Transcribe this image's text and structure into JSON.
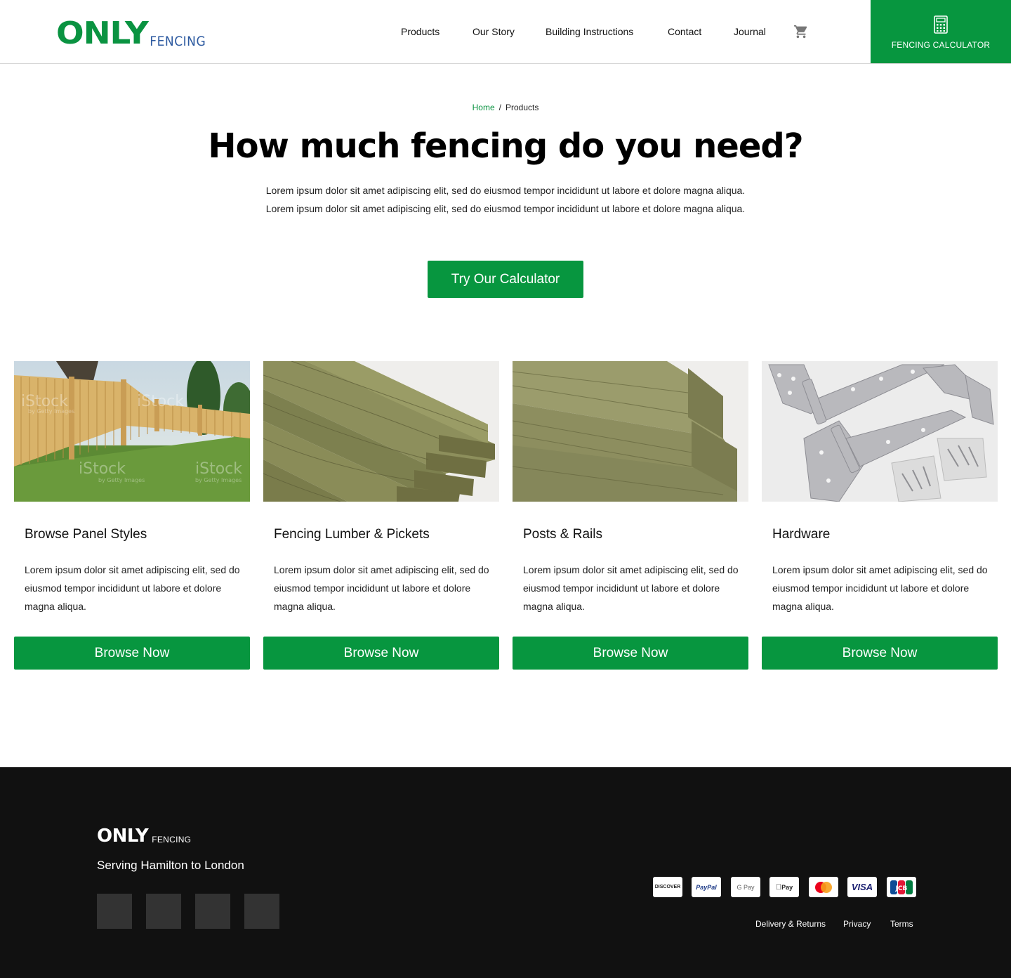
{
  "brand": {
    "logo_main": "ONLY",
    "logo_sub": "FENCING",
    "green": "#07963f",
    "logo_blue": "#2d5aa0",
    "footer_bg": "#111111"
  },
  "nav": {
    "items": [
      "Products",
      "Our Story",
      "Building Instructions",
      "Contact",
      "Journal"
    ],
    "cart_icon": "shopping-cart-icon",
    "calculator_label": "FENCING CALCULATOR",
    "calculator_icon": "calculator-icon"
  },
  "breadcrumb": {
    "home": "Home",
    "separator": "/",
    "current": "Products"
  },
  "hero": {
    "title": "How much fencing do you need?",
    "text": "Lorem ipsum dolor sit amet adipiscing elit, sed do eiusmod tempor incididunt ut labore et dolore magna aliqua. Lorem ipsum dolor sit amet adipiscing elit, sed do eiusmod tempor incididunt ut labore et dolore magna aliqua.",
    "cta": "Try Our Calculator"
  },
  "cards": [
    {
      "title": "Browse Panel Styles",
      "text": "Lorem ipsum dolor sit amet adipiscing elit, sed do eiusmod tempor incididunt ut labore et dolore magna aliqua.",
      "button": "Browse Now",
      "image": "wood-panel-fence-photo"
    },
    {
      "title": "Fencing Lumber & Pickets",
      "text": "Lorem ipsum dolor sit amet adipiscing elit, sed do eiusmod tempor incididunt ut labore et dolore magna aliqua.",
      "button": "Browse Now",
      "image": "lumber-boards-photo"
    },
    {
      "title": "Posts & Rails",
      "text": "Lorem ipsum dolor sit amet adipiscing elit, sed do eiusmod tempor incididunt ut labore et dolore magna aliqua.",
      "button": "Browse Now",
      "image": "wood-posts-photo"
    },
    {
      "title": "Hardware",
      "text": "Lorem ipsum dolor sit amet adipiscing elit, sed do eiusmod tempor incididunt ut labore et dolore magna aliqua.",
      "button": "Browse Now",
      "image": "gate-hinges-photo"
    }
  ],
  "watermark": {
    "brand": "iStock",
    "sub": "by Getty Images"
  },
  "footer": {
    "tagline": "Serving Hamilton to London",
    "social_icons": [
      "social-icon-1",
      "social-icon-2",
      "social-icon-3",
      "social-icon-4"
    ],
    "payments": [
      "DISCOVER",
      "PayPal",
      "G Pay",
      "Pay",
      "mastercard",
      "VISA",
      "JCB"
    ],
    "links": [
      "Delivery & Returns",
      "Privacy",
      "Terms"
    ]
  }
}
